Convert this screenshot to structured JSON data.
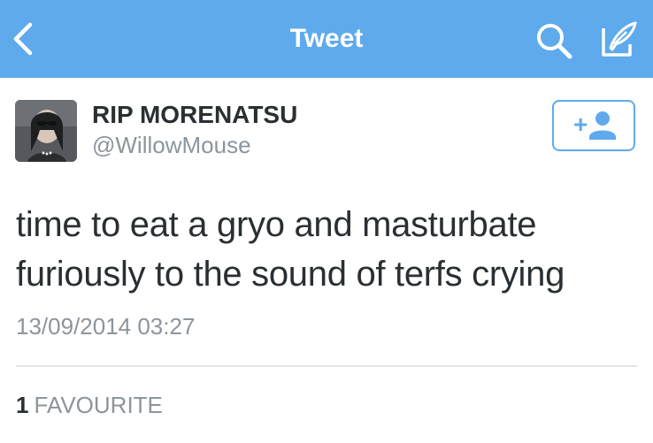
{
  "colors": {
    "nav_background": "#5eaaec",
    "nav_foreground": "#ffffff",
    "primary_text": "#2a2f33",
    "secondary_text": "#8c959d",
    "accent": "#5eaaec",
    "divider": "#e2e5e8"
  },
  "navbar": {
    "title": "Tweet",
    "back_icon": "chevron-left-icon",
    "search_icon": "search-icon",
    "compose_icon": "compose-quill-icon"
  },
  "tweet": {
    "author": {
      "display_name": "RIP MORENATSU",
      "handle": "@WillowMouse",
      "avatar": "avatar-photo"
    },
    "follow_button": {
      "icon": "add-user-icon",
      "label": "+"
    },
    "text_lines": [
      "time to eat a gryo and masturbate",
      "furiously to the sound of terfs crying"
    ],
    "timestamp": "13/09/2014 03:27",
    "stats": {
      "favourite_count": "1",
      "favourite_label": "FAVOURITE"
    }
  }
}
